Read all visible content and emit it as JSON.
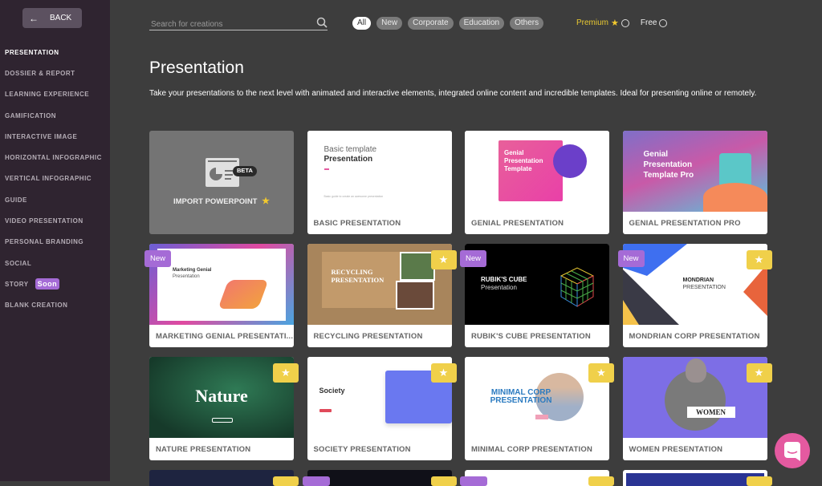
{
  "sidebar": {
    "back_label": "BACK",
    "items": [
      {
        "label": "PRESENTATION",
        "active": true
      },
      {
        "label": "DOSSIER & REPORT"
      },
      {
        "label": "LEARNING EXPERIENCE"
      },
      {
        "label": "GAMIFICATION"
      },
      {
        "label": "INTERACTIVE IMAGE"
      },
      {
        "label": "HORIZONTAL INFOGRAPHIC"
      },
      {
        "label": "VERTICAL INFOGRAPHIC"
      },
      {
        "label": "GUIDE"
      },
      {
        "label": "VIDEO PRESENTATION"
      },
      {
        "label": "PERSONAL BRANDING"
      },
      {
        "label": "SOCIAL"
      },
      {
        "label": "STORY",
        "badge": "Soon"
      },
      {
        "label": "BLANK CREATION"
      }
    ]
  },
  "search": {
    "placeholder": "Search for creations",
    "value": ""
  },
  "filters": [
    "All",
    "New",
    "Corporate",
    "Education",
    "Others"
  ],
  "plan": {
    "premium": "Premium",
    "free": "Free"
  },
  "page": {
    "title": "Presentation",
    "description": "Take your presentations to the next level with animated and interactive elements, integrated online content and incredible templates. Ideal for presenting online or remotely."
  },
  "cards": [
    {
      "label": "IMPORT POWERPOINT",
      "beta": "BETA",
      "premium": true
    },
    {
      "label": "BASIC PRESENTATION",
      "thumb_title": "Basic template",
      "thumb_sub": "Presentation",
      "thumb_caption": "Basic guide to create an awesome presentation"
    },
    {
      "label": "GENIAL PRESENTATION",
      "thumb_title": "Genial Presentation Template"
    },
    {
      "label": "GENIAL PRESENTATION PRO",
      "thumb_title": "Genial Presentation Template Pro"
    },
    {
      "label": "MARKETING GENIAL PRESENTATI...",
      "new": "New",
      "thumb_title": "Marketing Genial",
      "thumb_sub": "Presentation"
    },
    {
      "label": "RECYCLING PRESENTATION",
      "premium": true,
      "thumb_title": "RECYCLING PRESENTATION"
    },
    {
      "label": "RUBIK'S CUBE PRESENTATION",
      "new": "New",
      "thumb_title": "RUBIK'S CUBE",
      "thumb_sub": "Presentation"
    },
    {
      "label": "MONDRIAN CORP PRESENTATION",
      "new": "New",
      "premium": true,
      "thumb_title": "MONDRIAN",
      "thumb_sub": "PRESENTATION"
    },
    {
      "label": "NATURE PRESENTATION",
      "premium": true,
      "thumb_title": "Nature"
    },
    {
      "label": "SOCIETY PRESENTATION",
      "premium": true,
      "thumb_title": "Society"
    },
    {
      "label": "MINIMAL CORP PRESENTATION",
      "premium": true,
      "thumb_title": "MINIMAL CORP PRESENTATION"
    },
    {
      "label": "WOMEN PRESENTATION",
      "premium": true,
      "thumb_title": "WOMEN"
    }
  ],
  "colors": {
    "accent_purple": "#a56bd6",
    "premium_yellow": "#f0d04a",
    "chat_pink": "#e45aa0"
  }
}
